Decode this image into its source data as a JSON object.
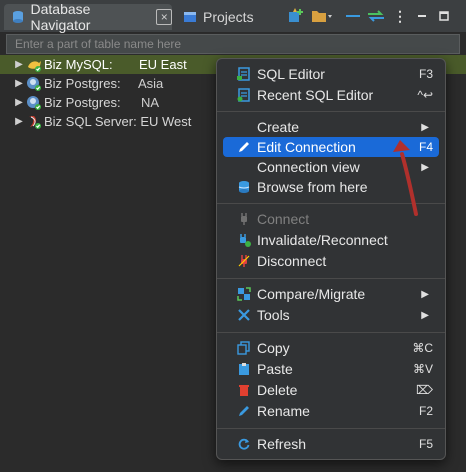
{
  "tabs": {
    "navigator": {
      "label": "Database Navigator",
      "close": "☒"
    },
    "projects": {
      "label": "Projects"
    }
  },
  "filter": {
    "placeholder": "Enter a part of table name here"
  },
  "tree": [
    {
      "name": "Biz MySQL:",
      "region": "EU East",
      "selected": true
    },
    {
      "name": "Biz Postgres:",
      "region": "Asia",
      "selected": false
    },
    {
      "name": "Biz Postgres:",
      "region": "NA",
      "selected": false
    },
    {
      "name": "Biz SQL Server: EU West",
      "region": "",
      "selected": false
    }
  ],
  "menu": {
    "sql_editor": {
      "label": "SQL Editor",
      "shortcut": "F3"
    },
    "recent_sql_editor": {
      "label": "Recent SQL Editor",
      "shortcut": "^↩"
    },
    "create": {
      "label": "Create"
    },
    "edit_connection": {
      "label": "Edit Connection",
      "shortcut": "F4"
    },
    "connection_view": {
      "label": "Connection view"
    },
    "browse_from_here": {
      "label": "Browse from here"
    },
    "connect": {
      "label": "Connect"
    },
    "invalidate_reconnect": {
      "label": "Invalidate/Reconnect"
    },
    "disconnect": {
      "label": "Disconnect"
    },
    "compare_migrate": {
      "label": "Compare/Migrate"
    },
    "tools": {
      "label": "Tools"
    },
    "copy": {
      "label": "Copy",
      "shortcut": "⌘C"
    },
    "paste": {
      "label": "Paste",
      "shortcut": "⌘V"
    },
    "delete": {
      "label": "Delete",
      "shortcut": "⌦"
    },
    "rename": {
      "label": "Rename",
      "shortcut": "F2"
    },
    "refresh": {
      "label": "Refresh",
      "shortcut": "F5"
    }
  },
  "colors": {
    "highlight": "#1a6ad8",
    "selected_row": "#4a5b2a",
    "annotation_arrow": "#b0302c"
  }
}
